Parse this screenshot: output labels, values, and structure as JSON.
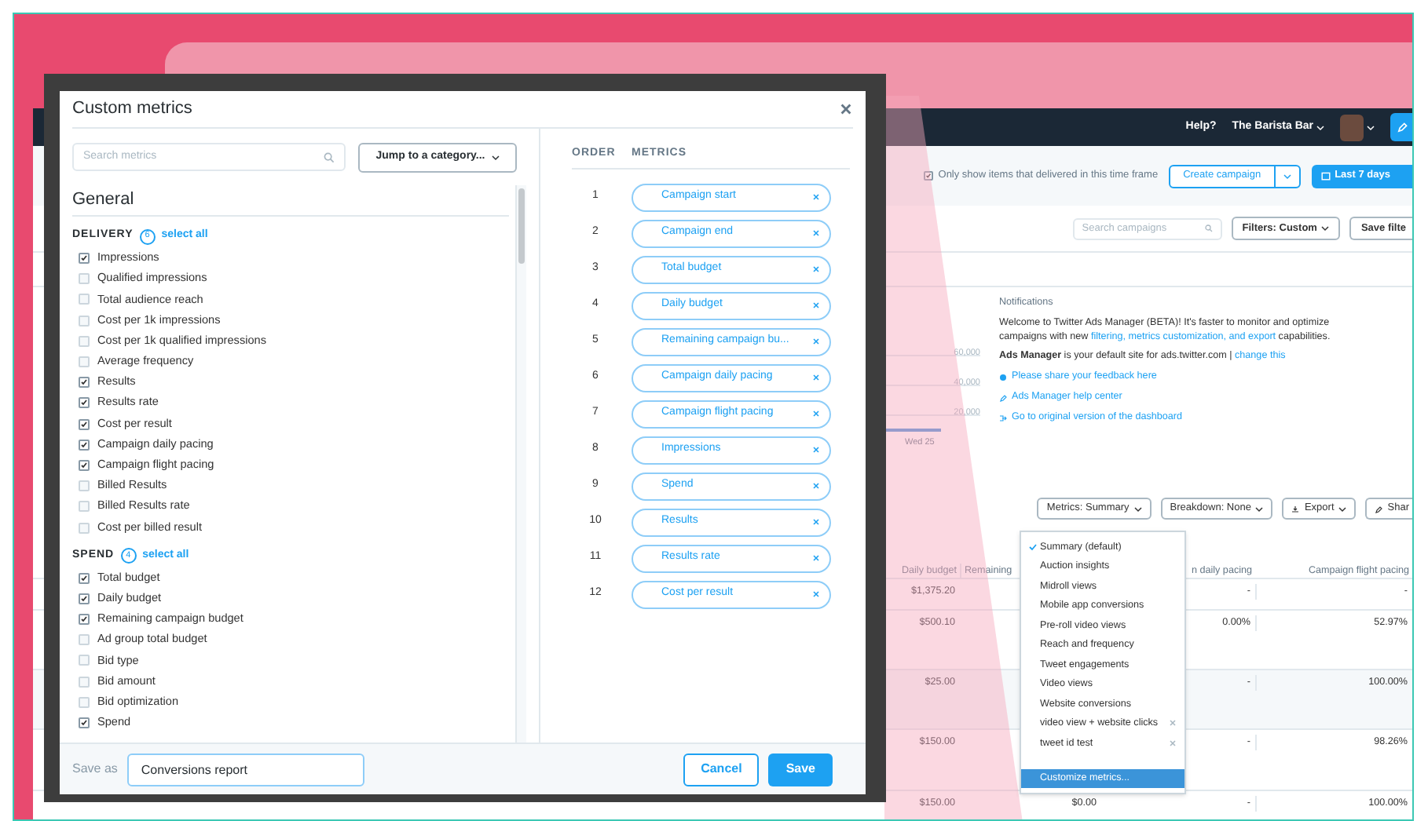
{
  "app": {
    "nav": {
      "help": "Help?",
      "account": "The Barista Bar"
    },
    "toolbar": {
      "delivered_filter": {
        "label": "Only show items that delivered in this time frame",
        "checked": true
      },
      "create_button": "Create campaign",
      "date_button": "Last 7 days"
    },
    "filters": {
      "search_placeholder": "Search campaigns",
      "filter_button": "Filters: Custom",
      "save_button": "Save filte"
    },
    "chart_axis": {
      "y_labels": [
        "60,000",
        "40,000",
        "20,000"
      ],
      "x_labels": [
        "Wed 25"
      ]
    },
    "notifications": {
      "title": "Notifications",
      "welcome": {
        "before": "Welcome to Twitter Ads Manager (BETA)! It's faster to monitor and optimize campaigns with new",
        "link": "filtering, metrics customization, and export",
        "after": "capabilities."
      },
      "default_site": {
        "text": "**Ads Manager** is your default site for ads.twitter.com |",
        "link": "change this"
      },
      "links": [
        {
          "kind": "feedback",
          "label": "Please share your feedback here"
        },
        {
          "kind": "help",
          "label": "Ads Manager help center"
        },
        {
          "kind": "external",
          "label": "Go to original version of the dashboard"
        }
      ]
    },
    "table_controls": [
      {
        "kind": "plain",
        "label": "Metrics: Summary"
      },
      {
        "kind": "plain",
        "label": "Breakdown: None"
      },
      {
        "kind": "export",
        "label": "Export"
      },
      {
        "kind": "share",
        "label": "Shar"
      }
    ],
    "table": {
      "columns": [
        "Daily budget",
        "Remaining",
        "n daily pacing",
        "Campaign flight pacing"
      ],
      "rows": [
        {
          "daily_budget": "$1,375.20",
          "daily_pacing": "-",
          "flight_pacing": "-"
        },
        {
          "daily_budget": "$500.10",
          "daily_pacing": "0.00%",
          "flight_pacing": "52.97%"
        },
        {
          "daily_budget": "$25.00",
          "daily_pacing": "-",
          "flight_pacing": "100.00%"
        },
        {
          "daily_budget": "$150.00",
          "daily_pacing": "-",
          "flight_pacing": "98.26%"
        },
        {
          "daily_budget": "$150.00",
          "remaining": "$0.00",
          "daily_pacing": "-",
          "flight_pacing": "100.00%"
        }
      ]
    },
    "metrics_menu": [
      {
        "label": "Summary (default)",
        "selected": true,
        "removable": false,
        "highlighted": false
      },
      {
        "label": "Auction insights",
        "selected": false,
        "removable": false,
        "highlighted": false
      },
      {
        "label": "Midroll views",
        "selected": false,
        "removable": false,
        "highlighted": false
      },
      {
        "label": "Mobile app conversions",
        "selected": false,
        "removable": false,
        "highlighted": false
      },
      {
        "label": "Pre-roll video views",
        "selected": false,
        "removable": false,
        "highlighted": false
      },
      {
        "label": "Reach and frequency",
        "selected": false,
        "removable": false,
        "highlighted": false
      },
      {
        "label": "Tweet engagements",
        "selected": false,
        "removable": false,
        "highlighted": false
      },
      {
        "label": "Video views",
        "selected": false,
        "removable": false,
        "highlighted": false
      },
      {
        "label": "Website conversions",
        "selected": false,
        "removable": false,
        "highlighted": false
      },
      {
        "label": "video view + website clicks",
        "selected": false,
        "removable": true,
        "highlighted": false
      },
      {
        "label": "tweet id test",
        "selected": false,
        "removable": true,
        "highlighted": false
      },
      {
        "label": "Customize metrics...",
        "selected": false,
        "removable": false,
        "highlighted": true
      }
    ]
  },
  "modal": {
    "title": "Custom metrics",
    "search_placeholder": "Search metrics",
    "jump_button": "Jump to a category...",
    "section": "General",
    "groups": [
      {
        "name": "DELIVERY",
        "count": "6",
        "select_all": "select all",
        "items": [
          {
            "label": "Impressions",
            "checked": true
          },
          {
            "label": "Qualified impressions",
            "checked": false
          },
          {
            "label": "Total audience reach",
            "checked": false
          },
          {
            "label": "Cost per 1k impressions",
            "checked": false
          },
          {
            "label": "Cost per 1k qualified impressions",
            "checked": false
          },
          {
            "label": "Average frequency",
            "checked": false
          },
          {
            "label": "Results",
            "checked": true
          },
          {
            "label": "Results rate",
            "checked": true
          },
          {
            "label": "Cost per result",
            "checked": true
          },
          {
            "label": "Campaign daily pacing",
            "checked": true
          },
          {
            "label": "Campaign flight pacing",
            "checked": true
          },
          {
            "label": "Billed Results",
            "checked": false
          },
          {
            "label": "Billed Results rate",
            "checked": false
          },
          {
            "label": "Cost per billed result",
            "checked": false
          }
        ]
      },
      {
        "name": "SPEND",
        "count": "4",
        "select_all": "select all",
        "items": [
          {
            "label": "Total budget",
            "checked": true
          },
          {
            "label": "Daily budget",
            "checked": true
          },
          {
            "label": "Remaining campaign budget",
            "checked": true
          },
          {
            "label": "Ad group total budget",
            "checked": false
          },
          {
            "label": "Bid type",
            "checked": false
          },
          {
            "label": "Bid amount",
            "checked": false
          },
          {
            "label": "Bid optimization",
            "checked": false
          },
          {
            "label": "Spend",
            "checked": true
          }
        ]
      }
    ],
    "order_header": "ORDER",
    "metrics_header": "METRICS",
    "selected_metrics": [
      {
        "order": "1",
        "label": "Campaign start"
      },
      {
        "order": "2",
        "label": "Campaign end"
      },
      {
        "order": "3",
        "label": "Total budget"
      },
      {
        "order": "4",
        "label": "Daily budget"
      },
      {
        "order": "5",
        "label": "Remaining campaign bu..."
      },
      {
        "order": "6",
        "label": "Campaign daily pacing"
      },
      {
        "order": "7",
        "label": "Campaign flight pacing"
      },
      {
        "order": "8",
        "label": "Impressions"
      },
      {
        "order": "9",
        "label": "Spend"
      },
      {
        "order": "10",
        "label": "Results"
      },
      {
        "order": "11",
        "label": "Results rate"
      },
      {
        "order": "12",
        "label": "Cost per result"
      }
    ],
    "save_as_label": "Save as",
    "save_as_value": "Conversions report",
    "cancel_button": "Cancel",
    "save_button": "Save"
  }
}
